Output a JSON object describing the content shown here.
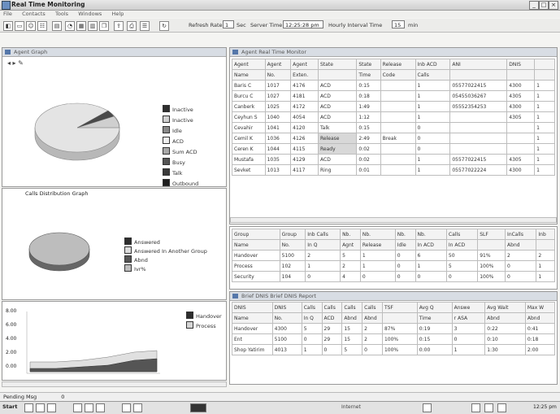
{
  "window": {
    "title": "Real Time Monitoring",
    "buttons": [
      "_",
      "□",
      "×"
    ]
  },
  "menu": [
    "File",
    "Contacts",
    "Tools",
    "Windows",
    "Help"
  ],
  "toolbar": {
    "refresh_label": "Refresh Rate",
    "refresh_value": "1",
    "refresh_unit": "Sec",
    "server_time_label": "Server Time:",
    "server_time_value": "12:25:28 pm",
    "interval_label": "Hourly Interval Time",
    "interval_value": "15",
    "interval_unit": "min"
  },
  "agent_graph_panel": {
    "title": "Agent Graph",
    "legend": [
      {
        "label": "Inactive",
        "color": "#2e2e2e"
      },
      {
        "label": "Inactive",
        "color": "#cfcfcf"
      },
      {
        "label": "Idle",
        "color": "#888888"
      },
      {
        "label": "ACD",
        "color": "#efefef"
      },
      {
        "label": "Sum ACD",
        "color": "#a8a8a8"
      },
      {
        "label": "Busy",
        "color": "#555555"
      },
      {
        "label": "Talk",
        "color": "#3a3a3a"
      },
      {
        "label": "Outbound",
        "color": "#1e1e1e"
      }
    ]
  },
  "calls_graph": {
    "title": "Calls Distribution Graph",
    "legend": [
      {
        "label": "Answered",
        "color": "#2e2e2e"
      },
      {
        "label": "Answered In Another Group",
        "color": "#dcdcdc"
      },
      {
        "label": "Abnd",
        "color": "#555555"
      },
      {
        "label": "Ivr%",
        "color": "#bdbdbd"
      }
    ]
  },
  "area_chart": {
    "y_ticks": [
      "8.00",
      "6.00",
      "4.00",
      "2.00",
      "0.00"
    ],
    "legend": [
      {
        "label": "Handover",
        "color": "#2e2e2e"
      },
      {
        "label": "Process",
        "color": "#d4d4d4"
      }
    ]
  },
  "agent_table": {
    "title": "Agent Real Time Monitor",
    "headers": [
      [
        "Agent",
        "Name"
      ],
      [
        "Agent",
        "No."
      ],
      [
        "Agent",
        "Exten."
      ],
      [
        "State",
        ""
      ],
      [
        "State",
        "Time"
      ],
      [
        "Release",
        "Code"
      ],
      [
        "Inb ACD",
        "Calls"
      ],
      [
        "ANI",
        ""
      ],
      [
        "DNIS",
        ""
      ],
      [
        "",
        ""
      ]
    ],
    "rows": [
      [
        "Baris C",
        "1017",
        "4176",
        "ACD",
        "0:15",
        "",
        "1",
        "05577022415",
        "4300",
        "1"
      ],
      [
        "Burcu C",
        "1027",
        "4181",
        "ACD",
        "0:18",
        "",
        "1",
        "05455036267",
        "4305",
        "1"
      ],
      [
        "Canberk",
        "1025",
        "4172",
        "ACD",
        "1:49",
        "",
        "1",
        "05552354253",
        "4300",
        "1"
      ],
      [
        "Ceyhun S",
        "1040",
        "4054",
        "ACD",
        "1:12",
        "",
        "1",
        "",
        "4305",
        "1"
      ],
      [
        "Cevahir",
        "1041",
        "4120",
        "Talk",
        "0:15",
        "",
        "0",
        "",
        "",
        "1"
      ],
      [
        "Cemil K",
        "1036",
        "4126",
        "Release",
        "2:49",
        "Break",
        "0",
        "",
        "",
        "1"
      ],
      [
        "Ceren K",
        "1044",
        "4115",
        "Ready",
        "0:02",
        "",
        "0",
        "",
        "",
        "1"
      ],
      [
        "Mustafa",
        "1035",
        "4129",
        "ACD",
        "0:02",
        "",
        "1",
        "05577022415",
        "4305",
        "1"
      ],
      [
        "Sevket",
        "1013",
        "4117",
        "Ring",
        "0:01",
        "",
        "1",
        "05577022224",
        "4300",
        "1"
      ]
    ]
  },
  "group_table": {
    "headers": [
      [
        "Group",
        "Name"
      ],
      [
        "Group",
        "No."
      ],
      [
        "Inb Calls",
        "In Q"
      ],
      [
        "Nb.",
        "Agnt"
      ],
      [
        "Nb.",
        "Release"
      ],
      [
        "Nb.",
        "Idle"
      ],
      [
        "Nb.",
        "In ACD"
      ],
      [
        "Calls",
        "In ACD"
      ],
      [
        "SLF",
        ""
      ],
      [
        "InCalls",
        "Abnd"
      ],
      [
        "Inb",
        ""
      ]
    ],
    "rows": [
      [
        "Handover",
        "5100",
        "2",
        "5",
        "1",
        "0",
        "6",
        "50",
        "91%",
        "2",
        "2"
      ],
      [
        "Process",
        "102",
        "1",
        "2",
        "1",
        "0",
        "1",
        "5",
        "100%",
        "0",
        "1"
      ],
      [
        "Security",
        "104",
        "0",
        "4",
        "0",
        "0",
        "0",
        "0",
        "100%",
        "0",
        "1"
      ]
    ]
  },
  "brief_table": {
    "title": "Brief DNIS Brief DNIS Report",
    "headers": [
      [
        "DNIS",
        "Name"
      ],
      [
        "DNIS",
        "No."
      ],
      [
        "Calls",
        "In Q"
      ],
      [
        "Calls",
        "ACD"
      ],
      [
        "Calls",
        "Abnd"
      ],
      [
        "Calls",
        "Abnd"
      ],
      [
        "TSF",
        ""
      ],
      [
        "Avg Q",
        "Time"
      ],
      [
        "Answe",
        "r ASA"
      ],
      [
        "Avg Wait",
        "Abnd"
      ],
      [
        "Max W",
        "Abnd"
      ]
    ],
    "rows": [
      [
        "Handover",
        "4300",
        "5",
        "29",
        "15",
        "2",
        "87%",
        "0:19",
        "3",
        "0:22",
        "0:41"
      ],
      [
        "Ent",
        "5100",
        "0",
        "29",
        "15",
        "2",
        "100%",
        "0:15",
        "0",
        "0:10",
        "0:18"
      ],
      [
        "Shop Yatirim",
        "4013",
        "1",
        "0",
        "5",
        "0",
        "100%",
        "0:00",
        "1",
        "1:30",
        "2:00"
      ]
    ]
  },
  "status_bar": {
    "label": "Pending Msg",
    "value": "0"
  },
  "taskbar": {
    "start": "Start",
    "clock": "12:25 pm",
    "app": "Internet"
  }
}
